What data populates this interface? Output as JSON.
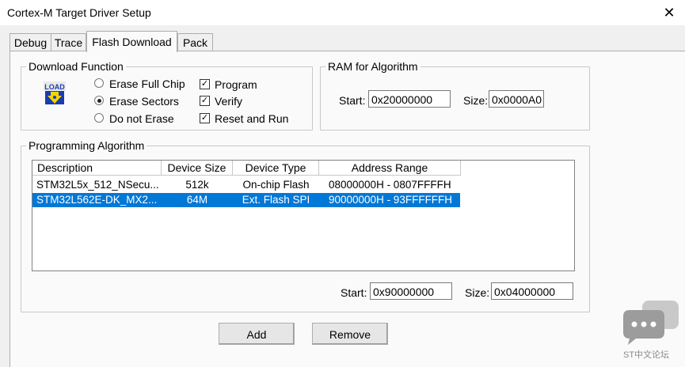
{
  "window": {
    "title": "Cortex-M Target Driver Setup",
    "close_glyph": "✕"
  },
  "tabs": [
    {
      "label": "Debug"
    },
    {
      "label": "Trace"
    },
    {
      "label": "Flash Download",
      "active": true
    },
    {
      "label": "Pack"
    }
  ],
  "download_function": {
    "title": "Download Function",
    "icon_text": "LOAD",
    "radios": [
      {
        "label": "Erase Full Chip",
        "selected": false
      },
      {
        "label": "Erase Sectors",
        "selected": true
      },
      {
        "label": "Do not Erase",
        "selected": false
      }
    ],
    "checkboxes": [
      {
        "label": "Program",
        "checked": true
      },
      {
        "label": "Verify",
        "checked": true
      },
      {
        "label": "Reset and Run",
        "checked": true
      }
    ]
  },
  "ram": {
    "title": "RAM for Algorithm",
    "start_label": "Start:",
    "start_value": "0x20000000",
    "size_label": "Size:",
    "size_value": "0x0000A0"
  },
  "programming": {
    "title": "Programming Algorithm",
    "columns": [
      "Description",
      "Device Size",
      "Device Type",
      "Address Range"
    ],
    "rows": [
      {
        "description": "STM32L5x_512_NSecu...",
        "size": "512k",
        "type": "On-chip Flash",
        "range": "08000000H - 0807FFFFH",
        "selected": false
      },
      {
        "description": "STM32L562E-DK_MX2...",
        "size": "64M",
        "type": "Ext. Flash SPI",
        "range": "90000000H - 93FFFFFFH",
        "selected": true
      }
    ],
    "start_label": "Start:",
    "start_value": "0x90000000",
    "size_label": "Size:",
    "size_value": "0x04000000"
  },
  "buttons": {
    "add": "Add",
    "remove": "Remove"
  },
  "watermark": {
    "text": "ST中文论坛"
  },
  "colors": {
    "selection": "#0078d7",
    "icon_blue": "#1a3cb0",
    "icon_yellow": "#f2d600"
  }
}
